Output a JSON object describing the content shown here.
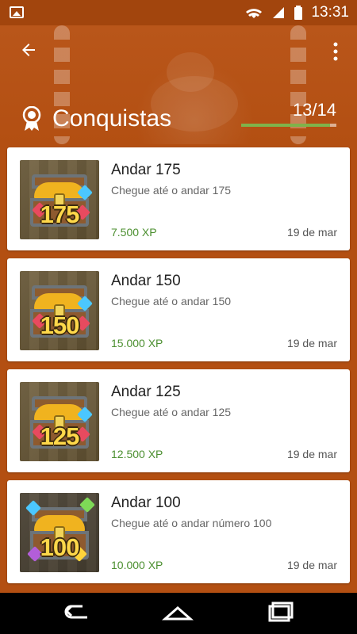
{
  "status": {
    "time": "13:31",
    "icons": [
      "image-icon",
      "wifi-icon",
      "signal-icon",
      "battery-icon"
    ]
  },
  "appbar": {
    "back_icon": "arrow-left-icon",
    "menu_icon": "more-vertical-icon"
  },
  "header": {
    "title": "Conquistas",
    "progress_text": "13/14",
    "progress_fraction": 0.93,
    "title_icon": "award-icon"
  },
  "cards": [
    {
      "title": "Andar 175",
      "description": "Chegue até o andar 175",
      "xp": "7.500 XP",
      "date": "19 de mar",
      "thumb_number": "175"
    },
    {
      "title": "Andar 150",
      "description": "Chegue até o andar 150",
      "xp": "15.000 XP",
      "date": "19 de mar",
      "thumb_number": "150"
    },
    {
      "title": "Andar 125",
      "description": "Chegue até o andar 125",
      "xp": "12.500 XP",
      "date": "19 de mar",
      "thumb_number": "125"
    },
    {
      "title": "Andar 100",
      "description": "Chegue até o andar número 100",
      "xp": "10.000 XP",
      "date": "19 de mar",
      "thumb_number": "100"
    }
  ],
  "navigation": {
    "back_icon": "nav-back-icon",
    "home_icon": "nav-home-icon",
    "recents_icon": "nav-recents-icon"
  }
}
